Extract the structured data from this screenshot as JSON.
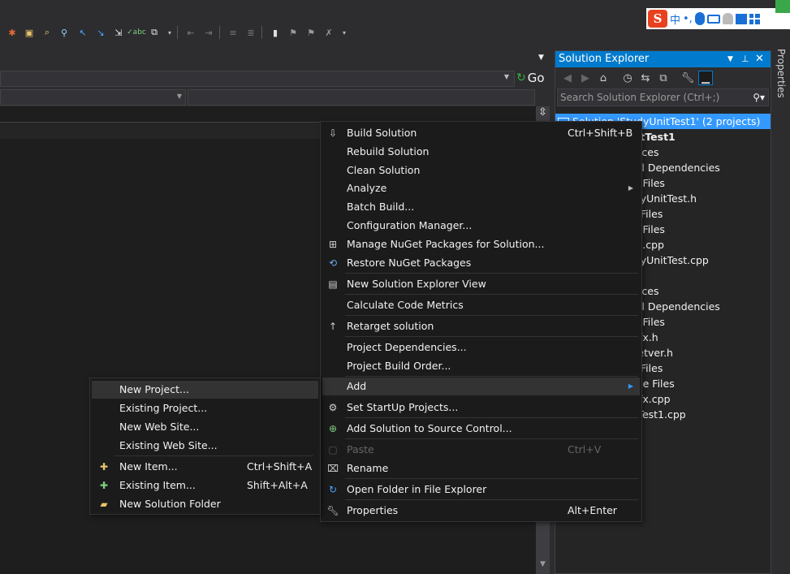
{
  "toolbar": {
    "icons": [
      "build-icon",
      "open-folder-icon",
      "find-icon",
      "find-replace-icon",
      "navigate-back-icon",
      "navigate-forward-icon",
      "step-icon",
      "spell-check-icon",
      "attach-icon",
      "dropdown-icon",
      "indent-icon",
      "outdent-icon",
      "comment-icon",
      "uncomment-icon",
      "bookmark-icon",
      "prev-bookmark-icon",
      "next-bookmark-icon",
      "dropdown-icon"
    ]
  },
  "navigation": {
    "go_label": "Go"
  },
  "solution_explorer": {
    "title": "Solution Explorer",
    "search_placeholder": "Search Solution Explorer (Ctrl+;)",
    "tree": [
      "Solution 'StudyUnitTest1' (2 projects)",
      "StudyUnitTest1",
      "References",
      "External Dependencies",
      "Header Files",
      "StudyUnitTest.h",
      "Source Files",
      "Header Files",
      "main.cpp",
      "StudyUnitTest.cpp",
      "",
      "References",
      "External Dependencies",
      "Header Files",
      "stdafx.h",
      "targetver.h",
      "Source Files",
      "Resource Files",
      "stdafx.cpp",
      "UnitTest1.cpp"
    ]
  },
  "properties_tab": "Properties",
  "context_menu": {
    "items": [
      {
        "label": "Build Solution",
        "shortcut": "Ctrl+Shift+B",
        "icon": "build-solution-icon"
      },
      {
        "label": "Rebuild Solution",
        "shortcut": ""
      },
      {
        "label": "Clean Solution",
        "shortcut": ""
      },
      {
        "label": "Analyze",
        "shortcut": "",
        "submenu": true
      },
      {
        "label": "Batch Build...",
        "shortcut": ""
      },
      {
        "label": "Configuration Manager...",
        "shortcut": ""
      },
      {
        "label": "Manage NuGet Packages for Solution...",
        "shortcut": "",
        "icon": "nuget-icon"
      },
      {
        "label": "Restore NuGet Packages",
        "shortcut": "",
        "icon": "restore-icon"
      },
      {
        "label": "New Solution Explorer View",
        "shortcut": "",
        "icon": "new-view-icon"
      },
      {
        "label": "Calculate Code Metrics",
        "shortcut": ""
      },
      {
        "label": "Retarget solution",
        "shortcut": "",
        "icon": "up-arrow-icon"
      },
      {
        "label": "Project Dependencies...",
        "shortcut": ""
      },
      {
        "label": "Project Build Order...",
        "shortcut": ""
      },
      {
        "label": "Add",
        "shortcut": "",
        "submenu": true
      },
      {
        "label": "Set StartUp Projects...",
        "shortcut": "",
        "icon": "gear-icon"
      },
      {
        "label": "Add Solution to Source Control...",
        "shortcut": "",
        "icon": "source-control-icon"
      },
      {
        "label": "Paste",
        "shortcut": "Ctrl+V",
        "icon": "paste-icon",
        "disabled": true
      },
      {
        "label": "Rename",
        "shortcut": "",
        "icon": "rename-icon"
      },
      {
        "label": "Open Folder in File Explorer",
        "shortcut": "",
        "icon": "refresh-icon"
      },
      {
        "label": "Properties",
        "shortcut": "Alt+Enter",
        "icon": "wrench-icon"
      }
    ]
  },
  "add_submenu": {
    "items": [
      {
        "label": "New Project...",
        "shortcut": ""
      },
      {
        "label": "Existing Project...",
        "shortcut": ""
      },
      {
        "label": "New Web Site...",
        "shortcut": ""
      },
      {
        "label": "Existing Web Site...",
        "shortcut": ""
      },
      {
        "label": "New Item...",
        "shortcut": "Ctrl+Shift+A",
        "icon": "new-item-icon"
      },
      {
        "label": "Existing Item...",
        "shortcut": "Shift+Alt+A",
        "icon": "existing-item-icon"
      },
      {
        "label": "New Solution Folder",
        "shortcut": "",
        "icon": "folder-icon"
      }
    ]
  },
  "ime_bar": {
    "lang": "中",
    "punct": "•,"
  }
}
